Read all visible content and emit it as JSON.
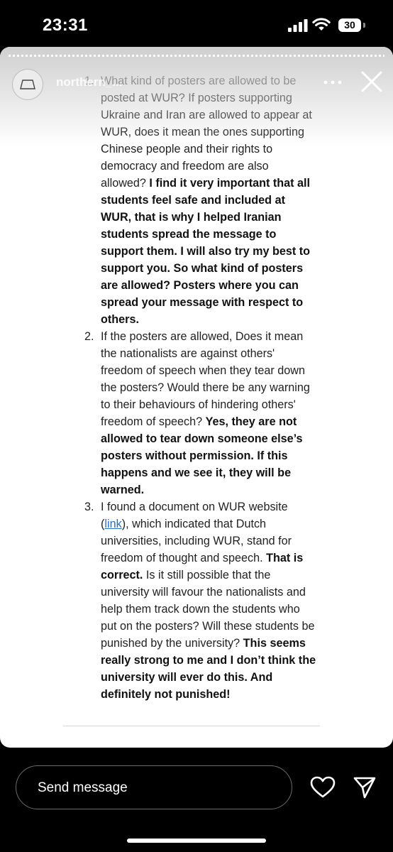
{
  "status_bar": {
    "time": "23:31",
    "battery": "30"
  },
  "story": {
    "username": "northern_..."
  },
  "document": {
    "items": [
      {
        "number": "1.",
        "parts": [
          {
            "t": "What kind of posters are allowed to be posted at WUR? If posters supporting Ukraine and Iran are allowed to appear at WUR, does it mean the ones supporting Chinese people and their rights to democracy and freedom are also allowed? ",
            "b": false
          },
          {
            "t": "I find it very important that all students feel safe and included at WUR, that is why I helped Iranian students spread the message to support them. I will also try my best to support you. So what kind of posters are allowed? Posters where you can spread your message with respect to others.",
            "b": true
          }
        ]
      },
      {
        "number": "2.",
        "parts": [
          {
            "t": "If the posters are allowed, Does it mean the nationalists are against others' freedom of speech when they tear down the posters? Would there be any warning to their behaviours of hindering others' freedom of speech? ",
            "b": false
          },
          {
            "t": "Yes, they are not allowed to tear down someone else’s posters without permission. If this happens and we see it, they will be warned.",
            "b": true
          }
        ]
      },
      {
        "number": "3.",
        "parts": [
          {
            "t": "I found a document on WUR website (",
            "b": false
          },
          {
            "t": "link",
            "link": true
          },
          {
            "t": "), which indicated that Dutch universities, including WUR, stand for freedom of thought and speech. ",
            "b": false
          },
          {
            "t": "That is correct.",
            "b": true
          },
          {
            "t": " Is it still possible that the university will favour the nationalists and help them track down the students who put on the posters? Will these students be punished by the university? ",
            "b": false
          },
          {
            "t": "This seems really strong to me and I don’t think the university will ever do this. And definitely not punished!",
            "b": true
          }
        ]
      }
    ]
  },
  "reply": {
    "placeholder": "Send message"
  },
  "icons": {
    "more": "more-dots-icon",
    "close": "close-icon",
    "heart": "heart-icon",
    "send": "send-icon",
    "signal": "signal-icon",
    "wifi": "wifi-icon",
    "battery": "battery-icon"
  },
  "colors": {
    "link": "#2a6fc0",
    "background": "#000000",
    "story_bg": "#ffffff"
  }
}
